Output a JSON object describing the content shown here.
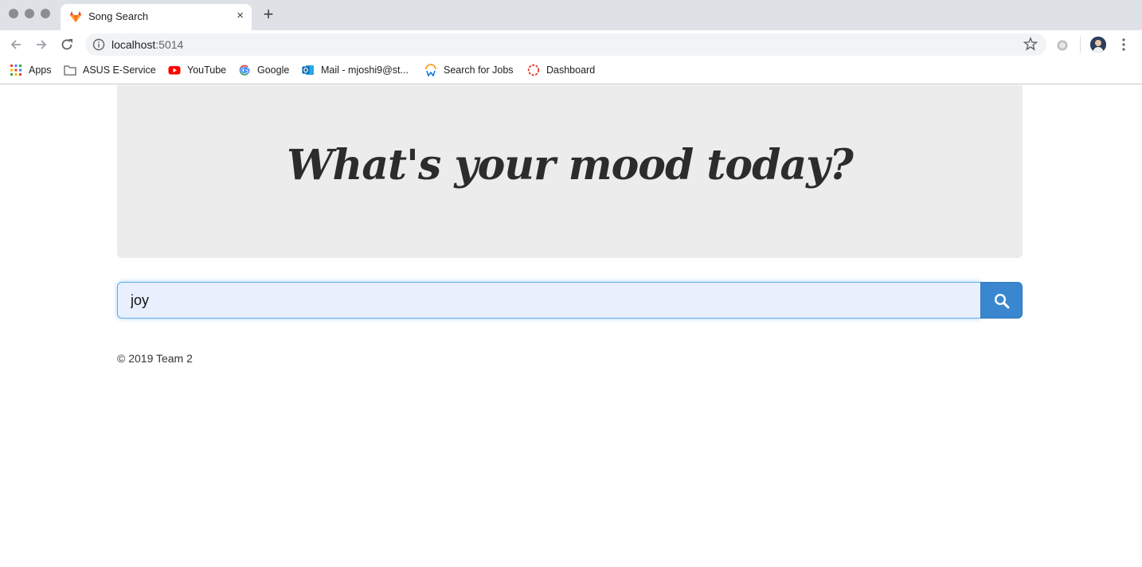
{
  "browser": {
    "tab": {
      "title": "Song Search",
      "close_glyph": "×",
      "favicon": "gitlab-fox-icon"
    },
    "new_tab_glyph": "+",
    "address": {
      "host": "localhost",
      "port": ":5014"
    },
    "bookmarks": [
      {
        "label": "Apps",
        "icon": "apps-grid-icon"
      },
      {
        "label": "ASUS E-Service",
        "icon": "folder-icon"
      },
      {
        "label": "YouTube",
        "icon": "youtube-icon"
      },
      {
        "label": "Google",
        "icon": "google-icon"
      },
      {
        "label": "Mail - mjoshi9@st...",
        "icon": "outlook-icon"
      },
      {
        "label": "Search for Jobs",
        "icon": "workday-icon"
      },
      {
        "label": "Dashboard",
        "icon": "dashboard-icon"
      }
    ]
  },
  "page": {
    "headline": "What's your mood today?",
    "search": {
      "value": "joy",
      "button_icon": "search-icon"
    },
    "footer": "© 2019 Team 2"
  },
  "colors": {
    "jumbotron_bg": "#ececec",
    "search_button": "#3a87d0",
    "input_autofill_bg": "#e8f0fe",
    "input_focus_border": "#66afe9"
  }
}
